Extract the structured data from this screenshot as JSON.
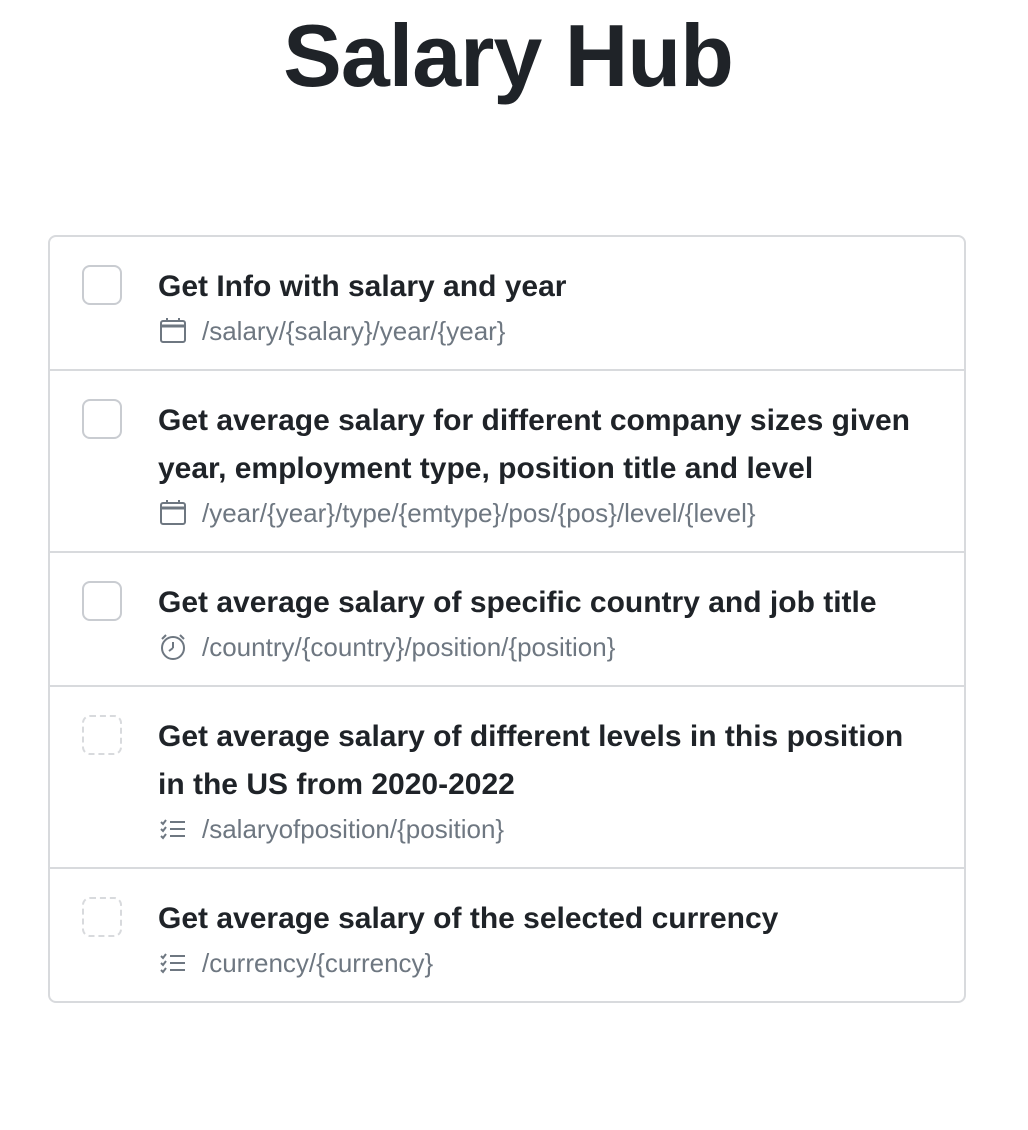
{
  "page": {
    "title": "Salary Hub"
  },
  "endpoints": [
    {
      "title": "Get Info with salary and year",
      "path": "/salary/{salary}/year/{year}",
      "icon": "calendar-icon",
      "checkbox_style": "solid"
    },
    {
      "title": "Get average salary for different company sizes given year, employment type, position title and level",
      "path": "/year/{year}/type/{emtype}/pos/{pos}/level/{level}",
      "icon": "calendar-icon",
      "checkbox_style": "solid"
    },
    {
      "title": "Get average salary of specific country and job title",
      "path": "/country/{country}/position/{position}",
      "icon": "alarm-clock-icon",
      "checkbox_style": "solid"
    },
    {
      "title": "Get average salary of different levels in this position in the US from 2020-2022",
      "path": "/salaryofposition/{position}",
      "icon": "checklist-icon",
      "checkbox_style": "dashed"
    },
    {
      "title": "Get average salary of the selected currency",
      "path": "/currency/{currency}",
      "icon": "checklist-icon",
      "checkbox_style": "dashed"
    }
  ],
  "colors": {
    "text": "#1f2328",
    "muted": "#6e7781",
    "border": "#d8dadd"
  }
}
